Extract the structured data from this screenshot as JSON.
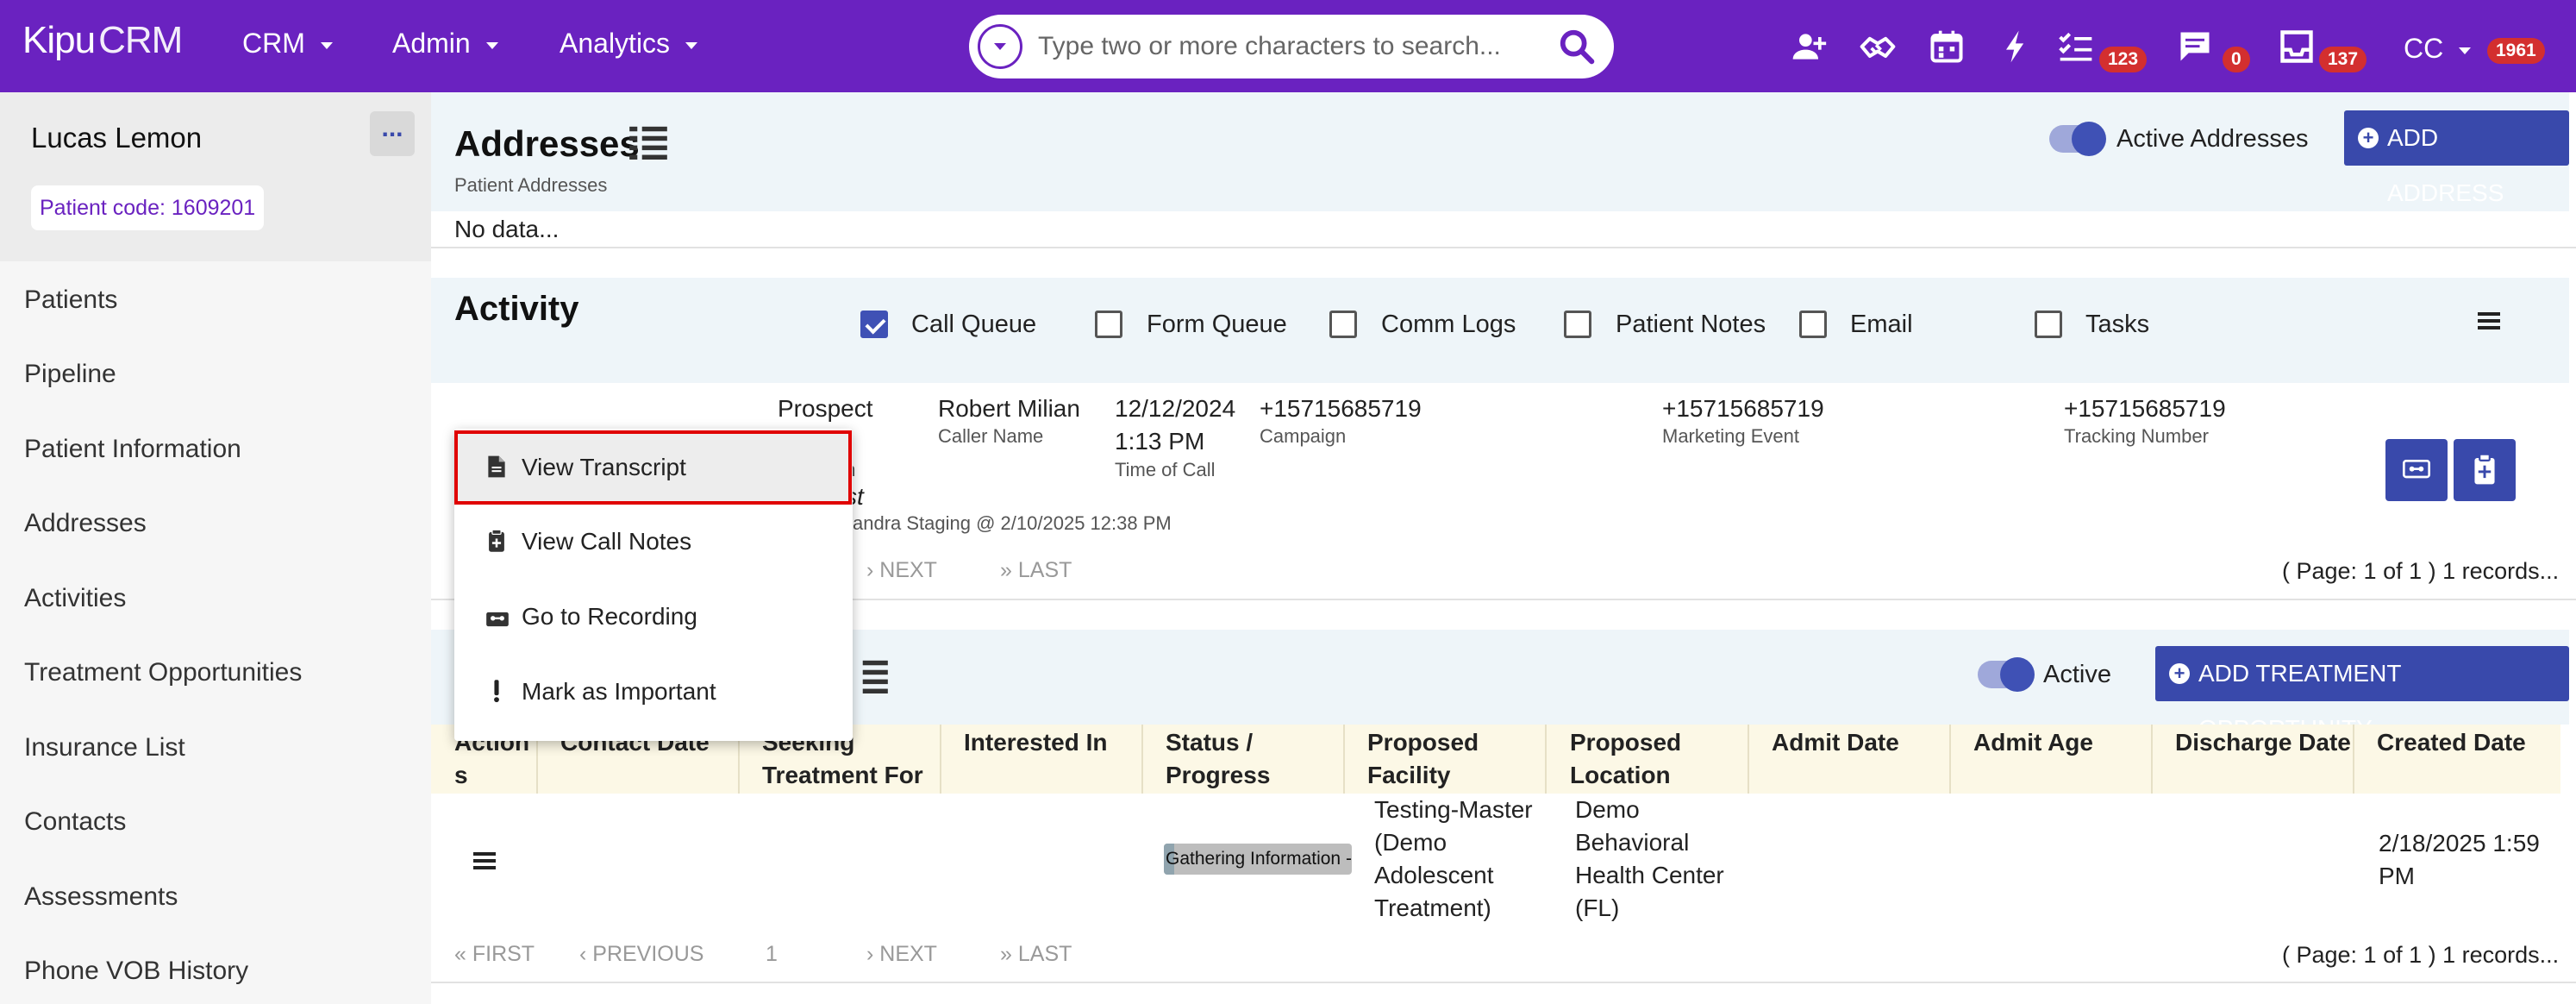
{
  "app": {
    "brand": "Kipu",
    "brand_suffix": "CRM",
    "nav": [
      "CRM",
      "Admin",
      "Analytics"
    ],
    "search": {
      "placeholder": "Type two or more characters to search..."
    },
    "badges": {
      "tasks": "123",
      "messages": "0",
      "inbox": "137",
      "user": "1961"
    },
    "user_initials": "CC",
    "icons": [
      "add-user-icon",
      "handshake-icon",
      "calendar-icon",
      "bolt-icon",
      "checklist-icon",
      "chat-icon",
      "inbox-icon",
      "search-icon"
    ],
    "colors": {
      "topbar": "#6a22c0",
      "primary": "#3949ab",
      "badge": "#d32f2f",
      "highlight": "#e00000"
    }
  },
  "sidebar": {
    "patient_name": "Lucas Lemon",
    "more_label": "...",
    "patient_code": "Patient code: 1609201",
    "items": [
      "Patients",
      "Pipeline",
      "Patient Information",
      "Addresses",
      "Activities",
      "Treatment Opportunities",
      "Insurance List",
      "Contacts",
      "Assessments",
      "Phone VOB History"
    ]
  },
  "addresses": {
    "title": "Addresses",
    "subtitle": "Patient Addresses",
    "toggle_label": "Active Addresses",
    "add_button": "ADD ADDRESS",
    "empty": "No data..."
  },
  "activity": {
    "title": "Activity",
    "filters": [
      {
        "label": "Call Queue",
        "checked": true
      },
      {
        "label": "Form Queue",
        "checked": false
      },
      {
        "label": "Comm Logs",
        "checked": false
      },
      {
        "label": "Patient Notes",
        "checked": false
      },
      {
        "label": "Email",
        "checked": false
      },
      {
        "label": "Tasks",
        "checked": false
      }
    ],
    "record": {
      "type": "Prospect",
      "type_label_partial": "on",
      "caller_name": "Robert Milian",
      "caller_name_label": "Caller Name",
      "time_date": "12/12/2024",
      "time_time": "1:13 PM",
      "time_label": "Time of Call",
      "campaign": "+15715685719",
      "campaign_label": "Campaign",
      "marketing_event": "+15715685719",
      "marketing_event_label": "Marketing Event",
      "tracking_number": "+15715685719",
      "tracking_number_label": "Tracking Number",
      "italic_partial": "st",
      "updated_partial": "andra Staging @ 2/10/2025 12:38 PM"
    },
    "pager": {
      "next": "NEXT",
      "last": "LAST",
      "info": "( Page: 1 of 1 ) 1 records..."
    }
  },
  "context_menu": {
    "items": [
      "View Transcript",
      "View Call Notes",
      "Go to Recording",
      "Mark as Important"
    ]
  },
  "treatment": {
    "toggle_label": "Active",
    "add_button": "ADD TREATMENT OPPORTUNITY",
    "columns": [
      "Action s",
      "Contact Date",
      "Seeking Treatment For",
      "Interested In",
      "Status / Progress",
      "Proposed Facility",
      "Proposed Location",
      "Admit Date",
      "Admit Age",
      "Discharge Date",
      "Created Date"
    ],
    "row": {
      "status": "Gathering Information -",
      "facility": [
        "Testing-Master",
        "(Demo",
        "Adolescent",
        "Treatment)"
      ],
      "location": [
        "Demo",
        "Behavioral",
        "Health Center",
        "(FL)"
      ],
      "created": [
        "2/18/2025 1:59",
        "PM"
      ]
    },
    "pager": {
      "first": "FIRST",
      "previous": "PREVIOUS",
      "page": "1",
      "next": "NEXT",
      "last": "LAST",
      "info": "( Page: 1 of 1 ) 1 records..."
    }
  }
}
